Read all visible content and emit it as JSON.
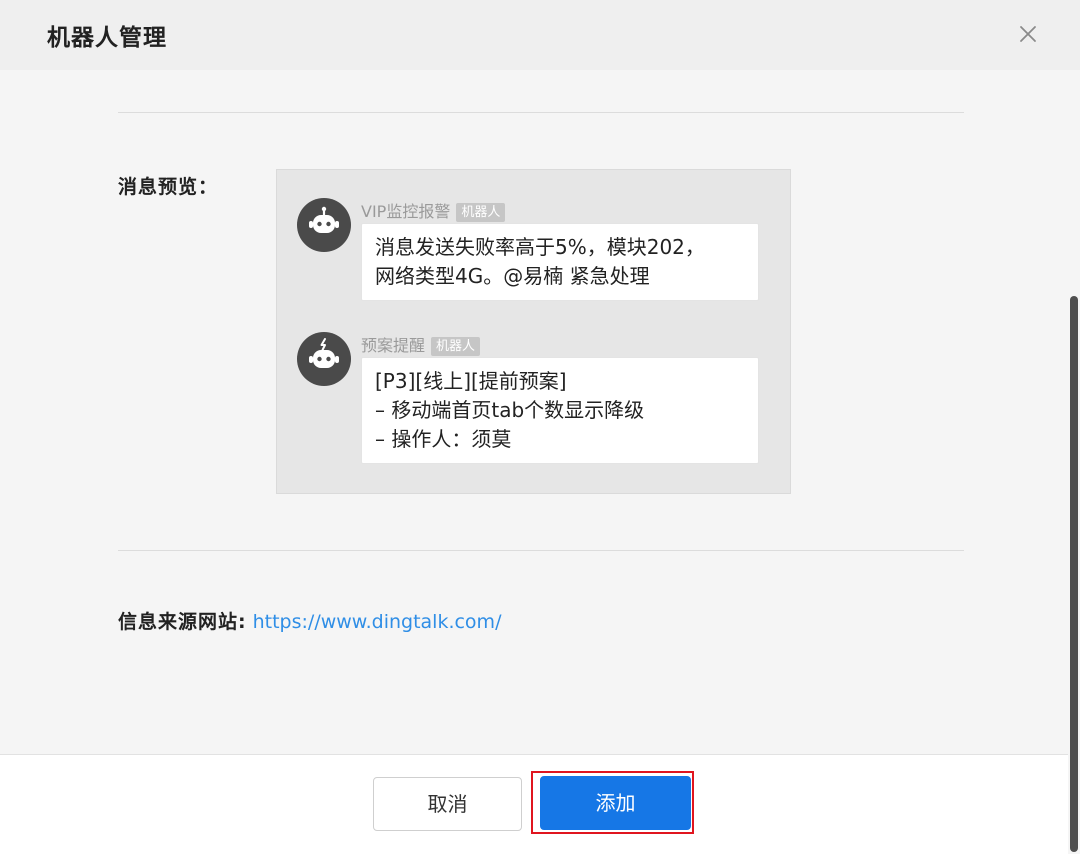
{
  "dialog": {
    "title": "机器人管理",
    "close_icon": "close-icon"
  },
  "preview": {
    "label": "消息预览：",
    "messages": [
      {
        "sender": "VIP监控报警",
        "tag": "机器人",
        "avatar_icon": "robot-icon",
        "text": "消息发送失败率高于5%，模块202，\n网络类型4G。@易楠 紧急处理"
      },
      {
        "sender": "预案提醒",
        "tag": "机器人",
        "avatar_icon": "robot-icon",
        "text": "[P3][线上][提前预案]\n– 移动端首页tab个数显示降级\n– 操作人：须莫"
      }
    ]
  },
  "source": {
    "label": "信息来源网站:",
    "url": "https://www.dingtalk.com/"
  },
  "footer": {
    "cancel_label": "取消",
    "add_label": "添加"
  },
  "colors": {
    "primary": "#1677e6",
    "link": "#2f8ee6",
    "highlight": "#e0151f"
  }
}
